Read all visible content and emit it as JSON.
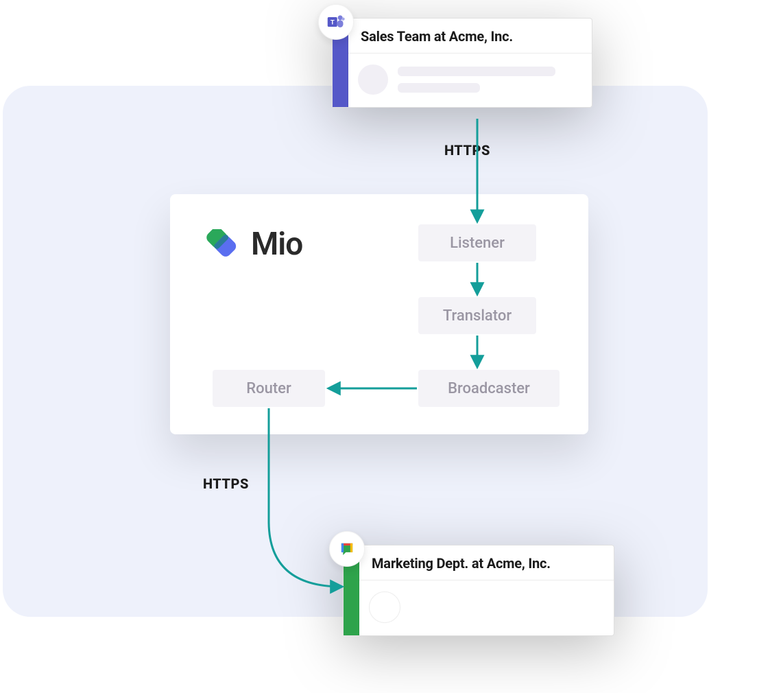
{
  "source_card": {
    "title": "Sales Team at Acme, Inc.",
    "platform": "microsoft-teams",
    "accent_color": "#5558c8"
  },
  "dest_card": {
    "title": "Marketing Dept. at Acme, Inc.",
    "platform": "google-chat",
    "accent_color": "#2ea34b"
  },
  "brand": {
    "name": "Mio"
  },
  "steps": {
    "listener": "Listener",
    "translator": "Translator",
    "broadcaster": "Broadcaster",
    "router": "Router"
  },
  "protocol": {
    "inbound": "HTTPS",
    "outbound": "HTTPS"
  },
  "colors": {
    "arrow": "#149e9a",
    "backdrop": "#eef1fb"
  }
}
